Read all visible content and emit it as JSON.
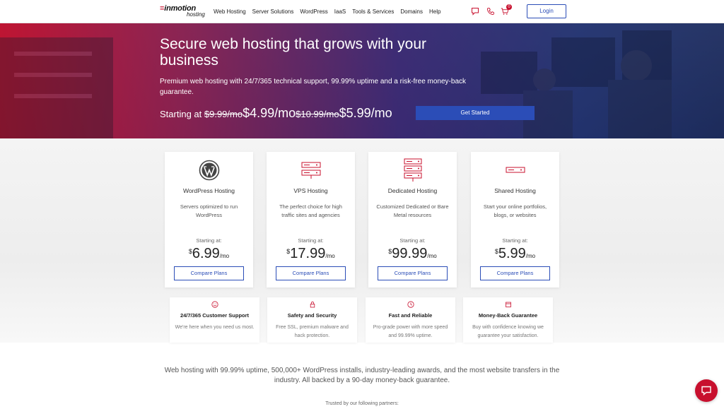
{
  "nav": {
    "logo_main": "inmotion",
    "logo_sub": "hosting",
    "links": [
      "Web Hosting",
      "Server Solutions",
      "WordPress",
      "IaaS",
      "Tools & Services",
      "Domains",
      "Help"
    ],
    "cart_count": "0",
    "login_label": "Login"
  },
  "hero": {
    "title": "Secure web hosting that grows with your business",
    "subtitle": "Premium web hosting with 24/7/365 technical support, 99.99% uptime and a risk-free money-back guarantee.",
    "starting_label": "Starting at ",
    "old_price_1": "$9.99/mo",
    "new_price_1": "$4.99/mo",
    "old_price_2": "$10.99/mo",
    "new_price_2": "$5.99/mo",
    "cta_label": "Get Started"
  },
  "plans": [
    {
      "title": "WordPress Hosting",
      "desc": "Servers optimized to run WordPress",
      "starting": "Starting at:",
      "currency": "$",
      "price": "6.99",
      "per": "/mo",
      "button": "Compare Plans",
      "icon": "wordpress-icon"
    },
    {
      "title": "VPS Hosting",
      "desc": "The perfect choice for high traffic sites and agencies",
      "starting": "Starting at:",
      "currency": "$",
      "price": "17.99",
      "per": "/mo",
      "button": "Compare Plans",
      "icon": "vps-server-icon"
    },
    {
      "title": "Dedicated Hosting",
      "desc": "Customized Dedicated or Bare Metal resources",
      "starting": "Starting at:",
      "currency": "$",
      "price": "99.99",
      "per": "/mo",
      "button": "Compare Plans",
      "icon": "dedicated-server-icon"
    },
    {
      "title": "Shared Hosting",
      "desc": "Start your online portfolios, blogs, or websites",
      "starting": "Starting at:",
      "currency": "$",
      "price": "5.99",
      "per": "/mo",
      "button": "Compare Plans",
      "icon": "shared-server-icon"
    }
  ],
  "features": [
    {
      "title": "24/7/365 Customer Support",
      "desc": "We're here when you need us most.",
      "icon": "smiley-icon"
    },
    {
      "title": "Safety and Security",
      "desc": "Free SSL, premium malware and hack protection.",
      "icon": "lock-icon"
    },
    {
      "title": "Fast and Reliable",
      "desc": "Pro-grade power with more speed and 99.99% uptime.",
      "icon": "clock-icon"
    },
    {
      "title": "Money-Back Guarantee",
      "desc": "Buy with confidence knowing we guarantee your satisfaction.",
      "icon": "calendar-icon"
    }
  ],
  "tagline": "Web hosting with 99.99% uptime, 500,000+ WordPress installs, industry-leading awards, and the most website transfers in the industry. All backed by a 90-day money-back guarantee.",
  "partners_label": "Trusted by our following partners:",
  "colors": {
    "brand_red": "#c8102e",
    "accent_blue": "#2b4db7"
  }
}
